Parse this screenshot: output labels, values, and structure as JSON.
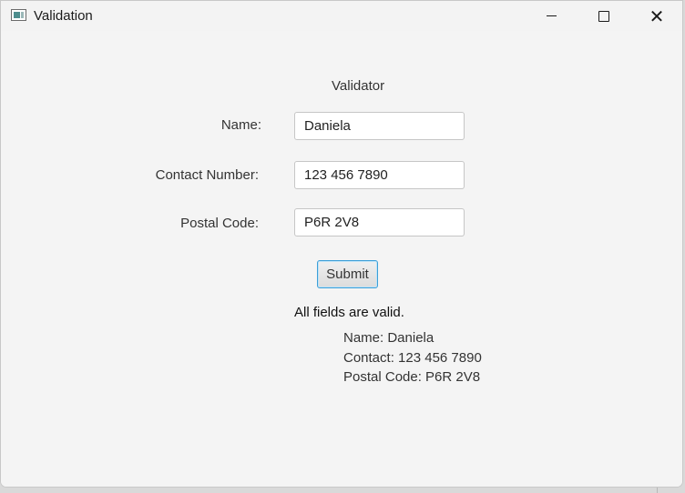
{
  "window": {
    "title": "Validation",
    "icon": "app-window-icon",
    "controls": {
      "minimize_icon": "minimize-icon",
      "maximize_icon": "maximize-icon",
      "close_icon": "close-icon",
      "close_glyph": "✕"
    }
  },
  "form": {
    "heading": "Validator",
    "name_label": "Name:",
    "name_value": "Daniela",
    "contact_label": "Contact Number:",
    "contact_value": "123 456 7890",
    "postal_label": "Postal Code:",
    "postal_value": "P6R 2V8",
    "submit_label": "Submit"
  },
  "result": {
    "status": "All fields are valid.",
    "summary_name": "Name: Daniela",
    "summary_contact": "Contact: 123 456 7890",
    "summary_postal": "Postal Code: P6R 2V8"
  },
  "colors": {
    "window_bg": "#f4f4f4",
    "focus_accent": "#3c9fd8"
  }
}
